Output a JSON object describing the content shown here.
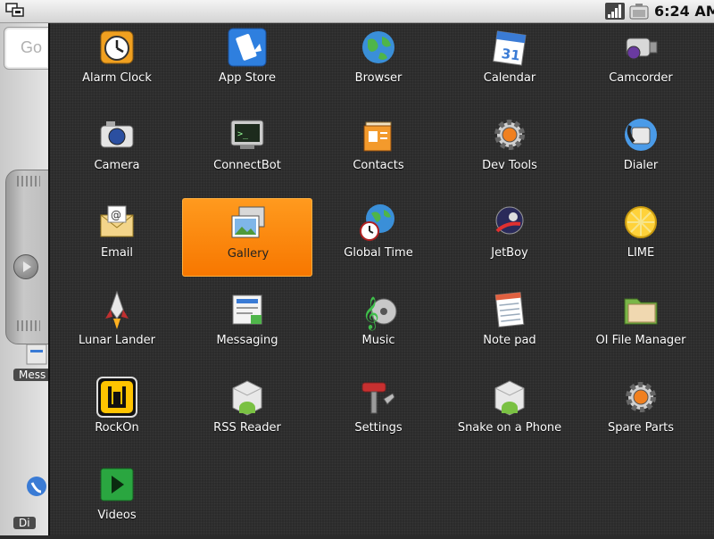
{
  "status_bar": {
    "time": "6:24 AM",
    "icons": [
      "network-icon",
      "signal-icon",
      "battery-icon"
    ]
  },
  "home_background": {
    "search_text": "Go",
    "partial_labels": [
      "Mess",
      "Di"
    ]
  },
  "apps": [
    {
      "label": "Alarm Clock",
      "icon": "alarm-clock-icon"
    },
    {
      "label": "App Store",
      "icon": "app-store-icon"
    },
    {
      "label": "Browser",
      "icon": "browser-globe-icon"
    },
    {
      "label": "Calendar",
      "icon": "calendar-icon"
    },
    {
      "label": "Camcorder",
      "icon": "camcorder-icon"
    },
    {
      "label": "Camera",
      "icon": "camera-icon"
    },
    {
      "label": "ConnectBot",
      "icon": "terminal-icon"
    },
    {
      "label": "Contacts",
      "icon": "contacts-icon"
    },
    {
      "label": "Dev Tools",
      "icon": "gear-icon"
    },
    {
      "label": "Dialer",
      "icon": "phone-icon"
    },
    {
      "label": "Email",
      "icon": "email-icon"
    },
    {
      "label": "Gallery",
      "icon": "gallery-icon"
    },
    {
      "label": "Global Time",
      "icon": "global-time-icon"
    },
    {
      "label": "JetBoy",
      "icon": "jetboy-icon"
    },
    {
      "label": "LIME",
      "icon": "lime-icon"
    },
    {
      "label": "Lunar Lander",
      "icon": "rocket-icon"
    },
    {
      "label": "Messaging",
      "icon": "messaging-icon"
    },
    {
      "label": "Music",
      "icon": "music-icon"
    },
    {
      "label": "Note pad",
      "icon": "notepad-icon"
    },
    {
      "label": "OI File Manager",
      "icon": "folder-icon"
    },
    {
      "label": "RockOn",
      "icon": "rockon-icon"
    },
    {
      "label": "RSS Reader",
      "icon": "android-package-icon"
    },
    {
      "label": "Settings",
      "icon": "settings-icon"
    },
    {
      "label": "Snake on a Phone",
      "icon": "android-package-icon"
    },
    {
      "label": "Spare Parts",
      "icon": "gear-icon"
    },
    {
      "label": "Videos",
      "icon": "play-icon"
    }
  ],
  "selected_app": "Gallery",
  "colors": {
    "selection": "#f77700",
    "drawer_bg": "#2b2b2b",
    "label": "#ffffff"
  }
}
